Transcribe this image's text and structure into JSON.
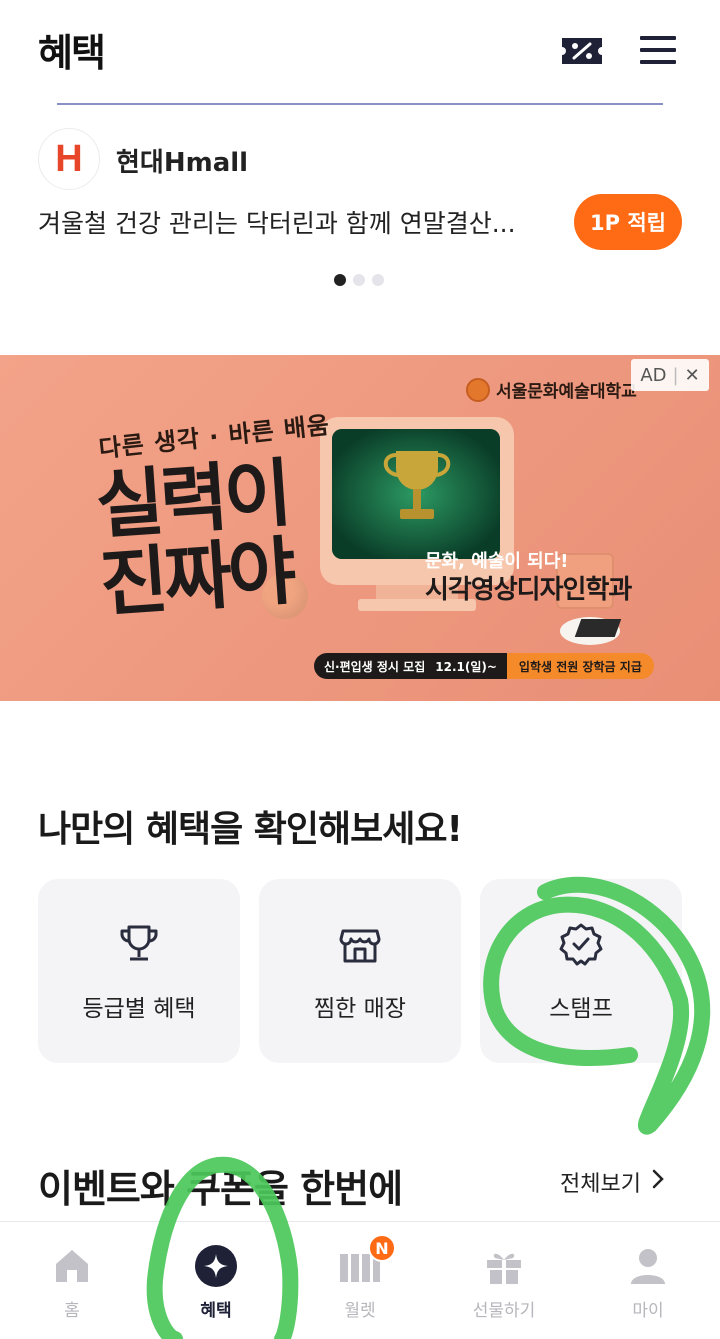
{
  "header": {
    "title": "혜택",
    "coupon_icon": "coupon-percent-icon",
    "menu_icon": "hamburger-menu-icon"
  },
  "partner": {
    "logo_letter": "H",
    "name": "현대Hmall",
    "description": "겨울철 건강 관리는 닥터린과 함께 연말결산...",
    "point_button": "1P 적립",
    "pager": {
      "total": 3,
      "active": 1
    }
  },
  "ad": {
    "badge": "AD",
    "school_name": "서울문화예술대학교",
    "slogan": "다른 생각 · 바른 배움",
    "headline_line1": "실력이",
    "headline_line2": "진짜야",
    "sub_line1": "문화, 예술이 되다!",
    "sub_line2": "시각영상디자인학과",
    "bar_left": "신·편입생 정시 모집",
    "bar_date": "12.1(일)~",
    "bar_right": "입학생 전원 장학금 지급"
  },
  "my_benefits": {
    "title": "나만의 혜택을 확인해보세요!",
    "cards": [
      {
        "label": "등급별 혜택",
        "icon": "trophy-icon"
      },
      {
        "label": "찜한 매장",
        "icon": "store-icon"
      },
      {
        "label": "스탬프",
        "icon": "stamp-badge-icon"
      }
    ]
  },
  "events": {
    "title": "이벤트와 쿠폰을 한번에",
    "see_all": "전체보기"
  },
  "bottom_nav": {
    "items": [
      {
        "label": "홈",
        "icon": "home-icon"
      },
      {
        "label": "혜택",
        "icon": "sparkle-icon"
      },
      {
        "label": "월렛",
        "icon": "wallet-icon",
        "badge": "N"
      },
      {
        "label": "선물하기",
        "icon": "gift-icon"
      },
      {
        "label": "마이",
        "icon": "person-icon"
      }
    ],
    "active": "혜택"
  },
  "colors": {
    "accent_orange": "#ff6a14",
    "nav_active": "#1f2137",
    "annotation_green": "#4cc85a"
  }
}
